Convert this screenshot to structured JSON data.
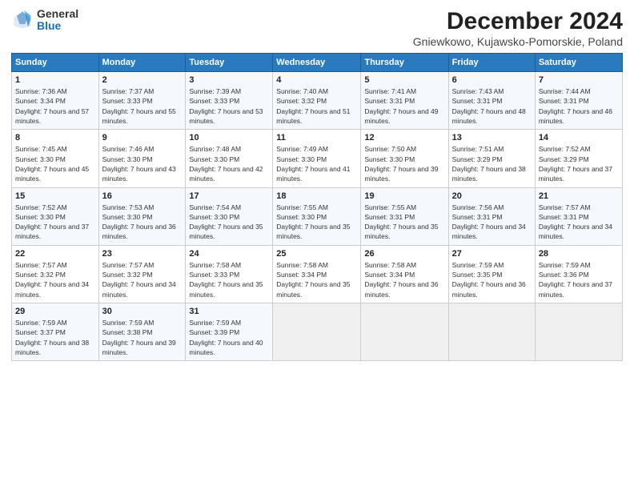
{
  "header": {
    "logo_general": "General",
    "logo_blue": "Blue",
    "title": "December 2024",
    "location": "Gniewkowo, Kujawsko-Pomorskie, Poland"
  },
  "weekdays": [
    "Sunday",
    "Monday",
    "Tuesday",
    "Wednesday",
    "Thursday",
    "Friday",
    "Saturday"
  ],
  "weeks": [
    [
      {
        "day": "1",
        "sunrise": "7:36 AM",
        "sunset": "3:34 PM",
        "daylight": "7 hours and 57 minutes."
      },
      {
        "day": "2",
        "sunrise": "7:37 AM",
        "sunset": "3:33 PM",
        "daylight": "7 hours and 55 minutes."
      },
      {
        "day": "3",
        "sunrise": "7:39 AM",
        "sunset": "3:33 PM",
        "daylight": "7 hours and 53 minutes."
      },
      {
        "day": "4",
        "sunrise": "7:40 AM",
        "sunset": "3:32 PM",
        "daylight": "7 hours and 51 minutes."
      },
      {
        "day": "5",
        "sunrise": "7:41 AM",
        "sunset": "3:31 PM",
        "daylight": "7 hours and 49 minutes."
      },
      {
        "day": "6",
        "sunrise": "7:43 AM",
        "sunset": "3:31 PM",
        "daylight": "7 hours and 48 minutes."
      },
      {
        "day": "7",
        "sunrise": "7:44 AM",
        "sunset": "3:31 PM",
        "daylight": "7 hours and 46 minutes."
      }
    ],
    [
      {
        "day": "8",
        "sunrise": "7:45 AM",
        "sunset": "3:30 PM",
        "daylight": "7 hours and 45 minutes."
      },
      {
        "day": "9",
        "sunrise": "7:46 AM",
        "sunset": "3:30 PM",
        "daylight": "7 hours and 43 minutes."
      },
      {
        "day": "10",
        "sunrise": "7:48 AM",
        "sunset": "3:30 PM",
        "daylight": "7 hours and 42 minutes."
      },
      {
        "day": "11",
        "sunrise": "7:49 AM",
        "sunset": "3:30 PM",
        "daylight": "7 hours and 41 minutes."
      },
      {
        "day": "12",
        "sunrise": "7:50 AM",
        "sunset": "3:30 PM",
        "daylight": "7 hours and 39 minutes."
      },
      {
        "day": "13",
        "sunrise": "7:51 AM",
        "sunset": "3:29 PM",
        "daylight": "7 hours and 38 minutes."
      },
      {
        "day": "14",
        "sunrise": "7:52 AM",
        "sunset": "3:29 PM",
        "daylight": "7 hours and 37 minutes."
      }
    ],
    [
      {
        "day": "15",
        "sunrise": "7:52 AM",
        "sunset": "3:30 PM",
        "daylight": "7 hours and 37 minutes."
      },
      {
        "day": "16",
        "sunrise": "7:53 AM",
        "sunset": "3:30 PM",
        "daylight": "7 hours and 36 minutes."
      },
      {
        "day": "17",
        "sunrise": "7:54 AM",
        "sunset": "3:30 PM",
        "daylight": "7 hours and 35 minutes."
      },
      {
        "day": "18",
        "sunrise": "7:55 AM",
        "sunset": "3:30 PM",
        "daylight": "7 hours and 35 minutes."
      },
      {
        "day": "19",
        "sunrise": "7:55 AM",
        "sunset": "3:31 PM",
        "daylight": "7 hours and 35 minutes."
      },
      {
        "day": "20",
        "sunrise": "7:56 AM",
        "sunset": "3:31 PM",
        "daylight": "7 hours and 34 minutes."
      },
      {
        "day": "21",
        "sunrise": "7:57 AM",
        "sunset": "3:31 PM",
        "daylight": "7 hours and 34 minutes."
      }
    ],
    [
      {
        "day": "22",
        "sunrise": "7:57 AM",
        "sunset": "3:32 PM",
        "daylight": "7 hours and 34 minutes."
      },
      {
        "day": "23",
        "sunrise": "7:57 AM",
        "sunset": "3:32 PM",
        "daylight": "7 hours and 34 minutes."
      },
      {
        "day": "24",
        "sunrise": "7:58 AM",
        "sunset": "3:33 PM",
        "daylight": "7 hours and 35 minutes."
      },
      {
        "day": "25",
        "sunrise": "7:58 AM",
        "sunset": "3:34 PM",
        "daylight": "7 hours and 35 minutes."
      },
      {
        "day": "26",
        "sunrise": "7:58 AM",
        "sunset": "3:34 PM",
        "daylight": "7 hours and 36 minutes."
      },
      {
        "day": "27",
        "sunrise": "7:59 AM",
        "sunset": "3:35 PM",
        "daylight": "7 hours and 36 minutes."
      },
      {
        "day": "28",
        "sunrise": "7:59 AM",
        "sunset": "3:36 PM",
        "daylight": "7 hours and 37 minutes."
      }
    ],
    [
      {
        "day": "29",
        "sunrise": "7:59 AM",
        "sunset": "3:37 PM",
        "daylight": "7 hours and 38 minutes."
      },
      {
        "day": "30",
        "sunrise": "7:59 AM",
        "sunset": "3:38 PM",
        "daylight": "7 hours and 39 minutes."
      },
      {
        "day": "31",
        "sunrise": "7:59 AM",
        "sunset": "3:39 PM",
        "daylight": "7 hours and 40 minutes."
      },
      null,
      null,
      null,
      null
    ]
  ]
}
